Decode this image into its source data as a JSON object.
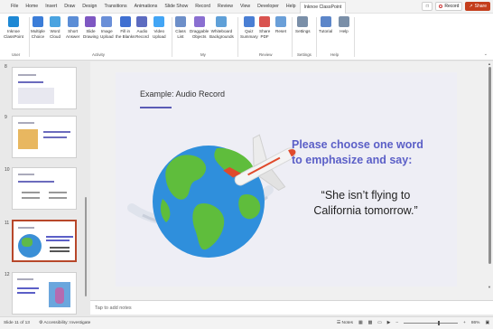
{
  "menu": {
    "tabs": [
      "File",
      "Home",
      "Insert",
      "Draw",
      "Design",
      "Transitions",
      "Animations",
      "Slide Show",
      "Record",
      "Review",
      "View",
      "Developer",
      "Help",
      "Inknoe ClassPoint"
    ],
    "active_tab": "Inknoe ClassPoint",
    "record_label": "Record",
    "share_label": "Share"
  },
  "ribbon": {
    "items": [
      {
        "label": "Inknoe\nClassPoint",
        "color": "#1e88d4"
      },
      {
        "label": "Multiple\nChoice",
        "color": "#3b7dd8"
      },
      {
        "label": "Word\nCloud",
        "color": "#4aa3e0"
      },
      {
        "label": "Short\nAnswer",
        "color": "#5b8dd6"
      },
      {
        "label": "Slide\nDrawing",
        "color": "#7e57c2"
      },
      {
        "label": "Image\nUpload",
        "color": "#6a8fd8"
      },
      {
        "label": "Fill in\nthe Blanks",
        "color": "#3f6fd1"
      },
      {
        "label": "Audio\nRecord",
        "color": "#5c6bc0"
      },
      {
        "label": "Video\nUpload",
        "color": "#42a5f5"
      },
      {
        "label": "Class\nList",
        "color": "#6d8fc9"
      },
      {
        "label": "Draggable\nObjects",
        "color": "#8a6fd1"
      },
      {
        "label": "Whiteboard\nBackgrounds",
        "color": "#5fa0d8"
      },
      {
        "label": "Quiz\nSummary",
        "color": "#4a7fd4"
      },
      {
        "label": "Share\nPDF",
        "color": "#d9534f"
      },
      {
        "label": "Reset",
        "color": "#6a9fd8"
      },
      {
        "label": "Settings",
        "color": "#7a8fa8"
      },
      {
        "label": "Tutorial",
        "color": "#5c86c9"
      },
      {
        "label": "Help",
        "color": "#7a8fa8"
      }
    ],
    "groups": [
      "User",
      "Activity",
      "My",
      "Review",
      "Settings",
      "Help"
    ]
  },
  "slides_panel": {
    "numbers": [
      "8",
      "9",
      "10",
      "11",
      "12"
    ],
    "selected": "11"
  },
  "slide": {
    "title": "Example: Audio Record",
    "prompt": "Please choose one word to emphasize and say:",
    "quote": "“She isn’t flying to California tomorrow.”"
  },
  "notes": {
    "placeholder": "Tap to add notes"
  },
  "status": {
    "slide_info": "Slide 11 of 13",
    "accessibility": "Accessibility: Investigate",
    "notes_label": "Notes",
    "zoom": "86%"
  },
  "colors": {
    "accent": "#5b5fc7",
    "share": "#c43e1c",
    "selected_thumb": "#b7472a"
  }
}
